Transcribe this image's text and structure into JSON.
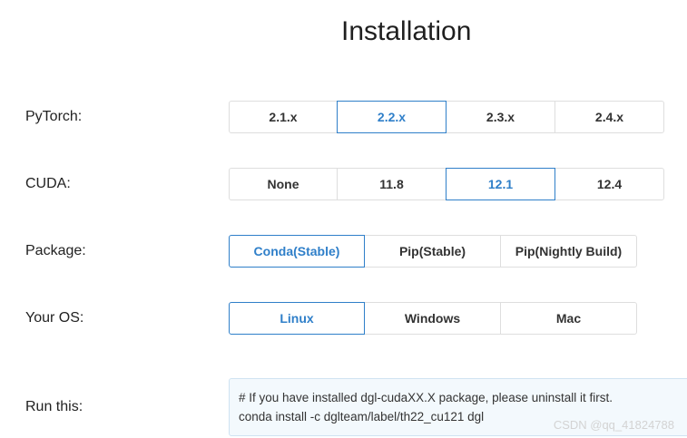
{
  "title": "Installation",
  "rows": {
    "pytorch": {
      "label": "PyTorch:",
      "options": [
        "2.1.x",
        "2.2.x",
        "2.3.x",
        "2.4.x"
      ],
      "selected": "2.2.x"
    },
    "cuda": {
      "label": "CUDA:",
      "options": [
        "None",
        "11.8",
        "12.1",
        "12.4"
      ],
      "selected": "12.1"
    },
    "package": {
      "label": "Package:",
      "options": [
        "Conda(Stable)",
        "Pip(Stable)",
        "Pip(Nightly Build)"
      ],
      "selected": "Conda(Stable)"
    },
    "os": {
      "label": "Your OS:",
      "options": [
        "Linux",
        "Windows",
        "Mac"
      ],
      "selected": "Linux"
    }
  },
  "run": {
    "label": "Run this:",
    "comment": "# If you have installed dgl-cudaXX.X package, please uninstall it first.",
    "command": "conda install -c dglteam/label/th22_cu121 dgl"
  },
  "watermark": "CSDN @qq_41824788",
  "colors": {
    "accent": "#2f7fc9",
    "border": "#dedede",
    "command_bg": "#f3f9fd"
  }
}
